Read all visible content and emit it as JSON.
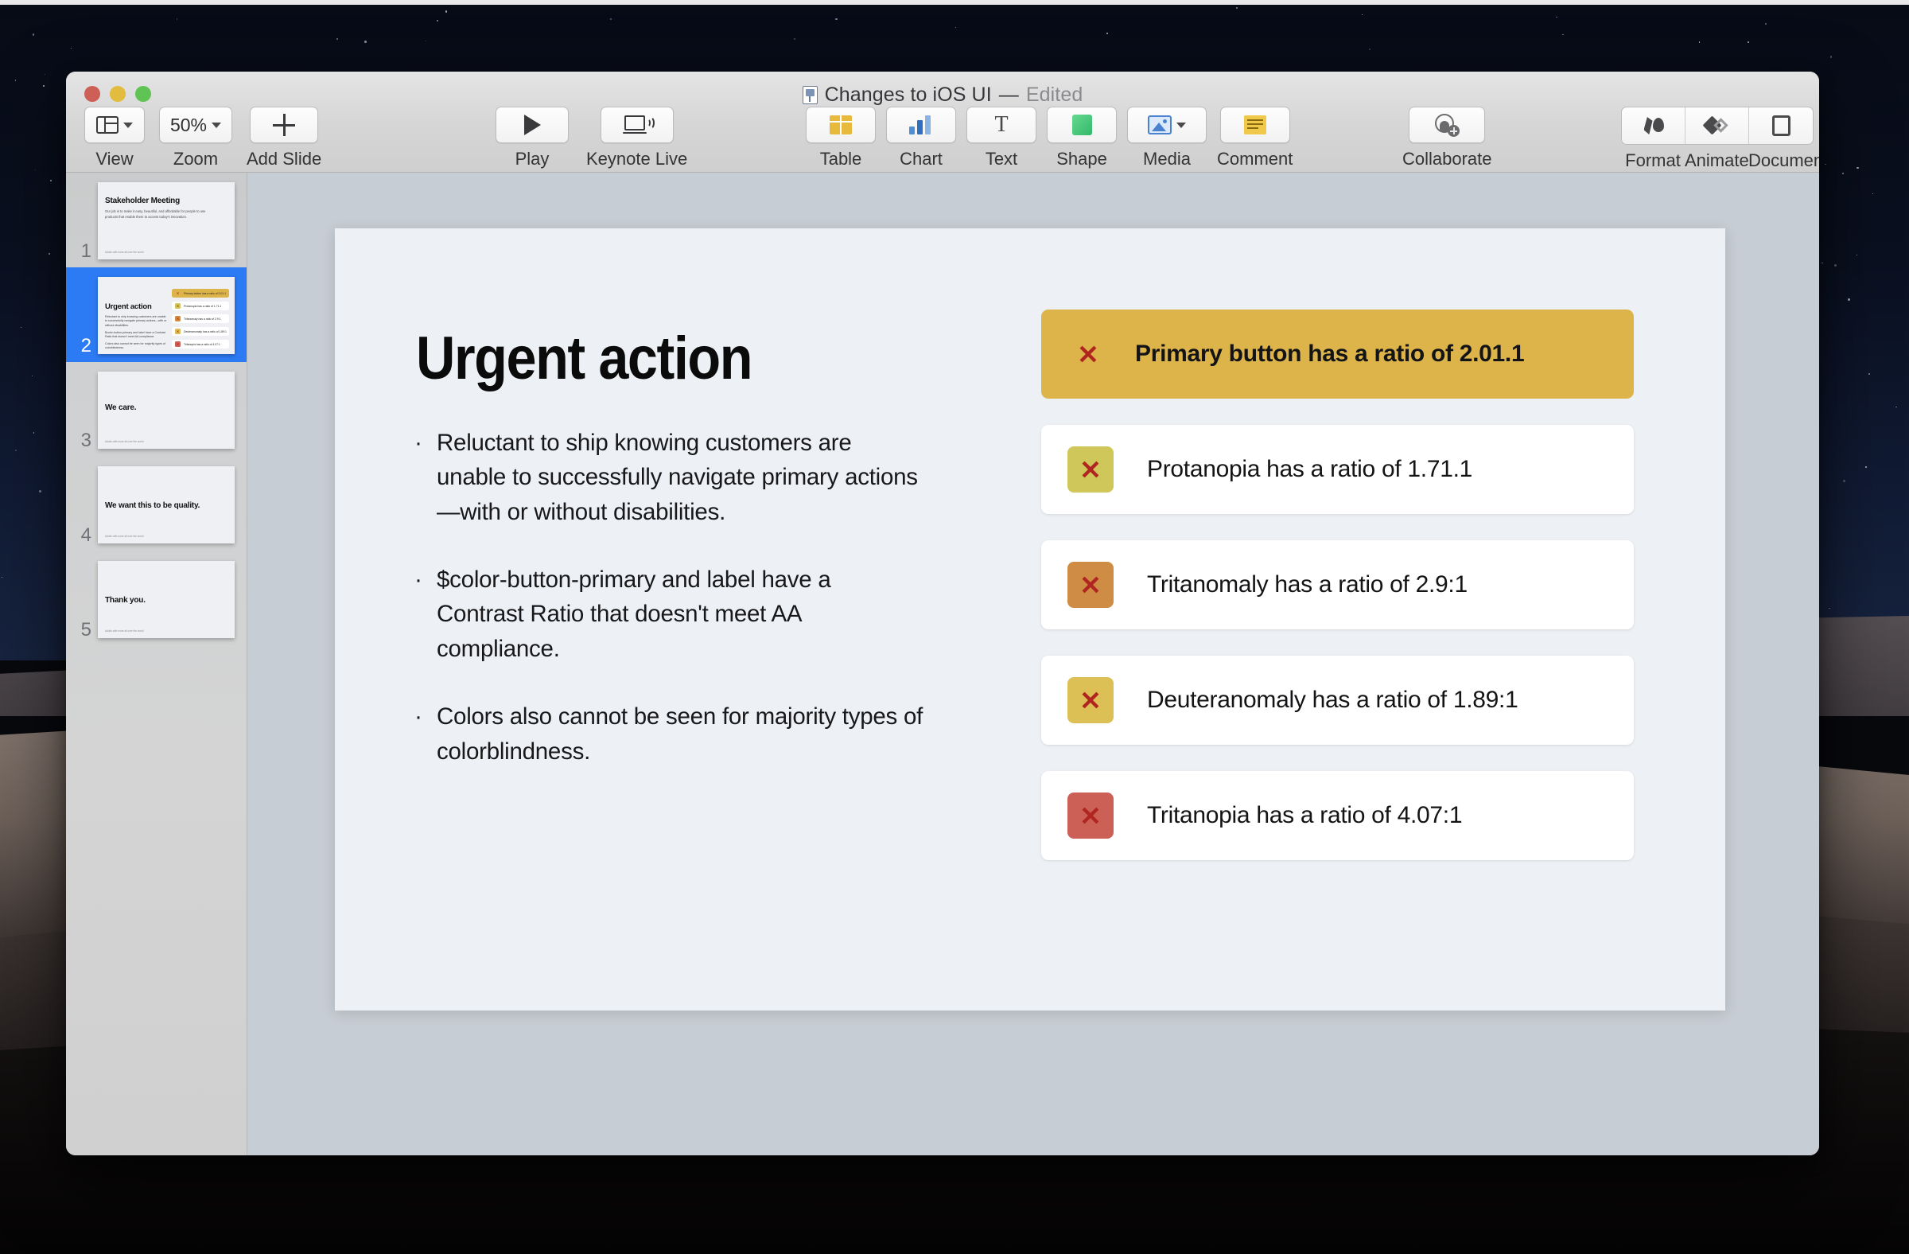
{
  "window": {
    "title": "Changes to iOS UI",
    "separator": "—",
    "edited_status": "Edited",
    "doc_icon": "keynote-document-icon",
    "traffic_lights": {
      "close": "close-button",
      "minimize": "minimize-button",
      "zoom": "maximize-button"
    }
  },
  "toolbar": {
    "left": [
      {
        "label": "View",
        "icon": "view-layout-icon",
        "has_chevron": true
      },
      {
        "label": "Zoom",
        "icon": "zoom-level-icon",
        "value": "50%",
        "has_chevron": true
      },
      {
        "label": "Add Slide",
        "icon": "plus-icon",
        "has_chevron": false
      }
    ],
    "play": [
      {
        "label": "Play",
        "icon": "play-triangle-icon"
      },
      {
        "label": "Keynote Live",
        "icon": "keynote-live-icon"
      }
    ],
    "insert": [
      {
        "label": "Table",
        "icon": "table-icon",
        "has_chevron": false
      },
      {
        "label": "Chart",
        "icon": "chart-bars-icon",
        "has_chevron": false
      },
      {
        "label": "Text",
        "icon": "text-t-icon",
        "has_chevron": false
      },
      {
        "label": "Shape",
        "icon": "shape-square-icon",
        "has_chevron": false
      },
      {
        "label": "Media",
        "icon": "media-photo-icon",
        "has_chevron": true
      },
      {
        "label": "Comment",
        "icon": "comment-note-icon",
        "has_chevron": false
      }
    ],
    "collaborate": {
      "label": "Collaborate",
      "icon": "collaborate-person-add-icon"
    },
    "inspector": [
      {
        "label": "Format",
        "icon": "format-brush-icon"
      },
      {
        "label": "Animate",
        "icon": "animate-diamond-icon"
      },
      {
        "label": "Document",
        "icon": "document-page-icon"
      }
    ]
  },
  "navigator": {
    "slides": [
      {
        "number": "1",
        "title": "Stakeholder Meeting",
        "body": "Our job is to make it easy, beautiful, and affordable for people to use products that enable them to access today's innovation.",
        "footer": "Adults with more all over the world",
        "selected": false
      },
      {
        "number": "2",
        "title": "Urgent action",
        "bullets": [
          "Reluctant to ship knowing customers are unable to successfully navigate primary actions—with or without disabilities.",
          "$color-button-primary and label have a Contrast Ratio that doesn't meet AA compliance.",
          "Colors also cannot be seen for majority types of colorblindness."
        ],
        "cards": [
          "Primary button has a ratio of 2.01.1",
          "Protanopia has a ratio of 1.71.1",
          "Tritanomaly has a ratio of 2.9:1",
          "Deuteranomaly has a ratio of 1.89:1",
          "Tritanopia has a ratio of 4.07:1"
        ],
        "selected": true
      },
      {
        "number": "3",
        "title": "We care.",
        "footer": "Adults with more all over the world",
        "selected": false
      },
      {
        "number": "4",
        "title": "We want this to be quality.",
        "footer": "Adults with more all over the world",
        "selected": false
      },
      {
        "number": "5",
        "title": "Thank you.",
        "footer": "Adults with more all over the world",
        "selected": false
      }
    ]
  },
  "slide": {
    "title": "Urgent action",
    "bullet_marker": "·",
    "bullets": [
      "Reluctant to ship knowing customers are unable to successfully navigate primary actions—with or without disabilities.",
      "$color-button-primary and label have a Contrast Ratio that doesn't meet AA compliance.",
      "Colors also cannot be seen for majority types of colorblindness."
    ],
    "cards": [
      {
        "text": "Primary button has a ratio of 2.01.1",
        "swatch_color": "#dcb44a",
        "card_color": "#dcb44a",
        "highlighted": true,
        "icon": "x-mark-icon"
      },
      {
        "text": "Protanopia has a ratio of 1.71.1",
        "swatch_color": "#cfc75a",
        "card_color": "#ffffff",
        "highlighted": false,
        "icon": "x-mark-icon"
      },
      {
        "text": "Tritanomaly has a ratio of 2.9:1",
        "swatch_color": "#cf8c44",
        "card_color": "#ffffff",
        "highlighted": false,
        "icon": "x-mark-icon"
      },
      {
        "text": "Deuteranomaly has a ratio of 1.89:1",
        "swatch_color": "#dcc055",
        "card_color": "#ffffff",
        "highlighted": false,
        "icon": "x-mark-icon"
      },
      {
        "text": "Tritanopia has a ratio of 4.07:1",
        "swatch_color": "#cd6056",
        "card_color": "#ffffff",
        "highlighted": false,
        "icon": "x-mark-icon"
      }
    ],
    "x_glyph": "✕",
    "background_color": "#edf0f4"
  },
  "colors": {
    "selection_blue": "#2d7bf4",
    "workspace": "#c7cdd4",
    "x_red": "#b0251f"
  }
}
